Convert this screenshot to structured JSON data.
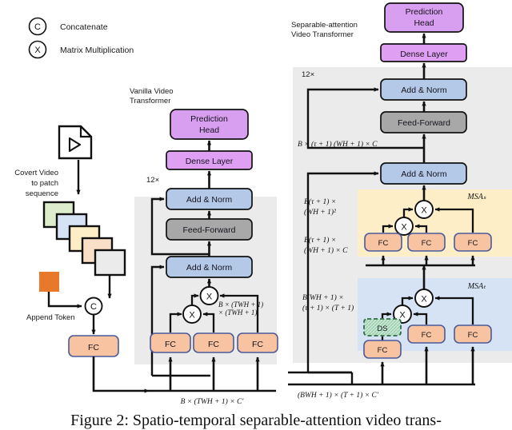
{
  "figure": {
    "caption": "Figure 2:  Spatio-temporal separable-attention video trans-"
  },
  "legend": {
    "items": [
      {
        "symbol": "C",
        "label": "Concatenate"
      },
      {
        "symbol": "X",
        "label": "Matrix Multiplication"
      }
    ]
  },
  "input_pipeline": {
    "video_icon_name": "video-file-icon",
    "convert_label_line1": "Covert Video",
    "convert_label_line2": "to patch",
    "convert_label_line3": "sequence",
    "append_token_label": "Append Token",
    "concat_symbol": "C",
    "fc_label": "FC",
    "patch_colors": [
      "#dceccd",
      "#d6e3f5",
      "#fdeec8",
      "#fadfc8",
      "#ebebeb"
    ],
    "append_token_color": "#e8782a"
  },
  "vanilla": {
    "title_line1": "Vanilla Video",
    "title_line2": "Transformer",
    "repeat_label": "12×",
    "prediction_head": "Prediction Head",
    "prediction_head_line1": "Prediction",
    "prediction_head_line2": "Head",
    "dense_layer": "Dense Layer",
    "add_norm_top": "Add & Norm",
    "feed_forward": "Feed-Forward",
    "add_norm_bottom": "Add & Norm",
    "fc_labels": [
      "FC",
      "FC",
      "FC"
    ],
    "matmul_symbol": "X",
    "attn_shape_line1": "B × (TWH + 1)",
    "attn_shape_line2": "× (TWH + 1)",
    "input_shape": "B × (TWH + 1)  × C′"
  },
  "separable": {
    "title_line1": "Separable-attention",
    "title_line2": "Video Transformer",
    "repeat_label": "12×",
    "prediction_head_line1": "Prediction",
    "prediction_head_line2": "Head",
    "dense_layer": "Dense Layer",
    "add_norm_top": "Add & Norm",
    "feed_forward": "Feed-Forward",
    "add_norm_mid": "Add & Norm",
    "ff_shape": "B × (τ + 1) (WH + 1) × C",
    "msa_s": {
      "name": "MSAₛ",
      "attn_shape_line1": "B(τ + 1) ×",
      "attn_shape_line2": "(WH + 1)²",
      "input_shape_line1": "B(τ + 1) ×",
      "input_shape_line2": "(WH + 1) × C",
      "fc_labels": [
        "FC",
        "FC",
        "FC"
      ],
      "matmul_symbol": "X",
      "bg_color": "#fdeec8"
    },
    "msa_t": {
      "name": "MSAₜ",
      "attn_shape_line1": "B(WH + 1) ×",
      "attn_shape_line2": "(τ + 1) × (T + 1)",
      "ds_label": "DS",
      "fc_labels": [
        "FC",
        "FC",
        "FC"
      ],
      "matmul_symbol": "X",
      "bg_color": "#d6e3f5"
    },
    "input_shape": "(BWH + 1) × (T + 1) × C′"
  },
  "colors": {
    "prediction_head": "#d89ef0",
    "dense_layer": "#df9ff2",
    "add_norm": "#b4c8e8",
    "feed_forward": "#a8a8a8",
    "fc": "#f7c3a0",
    "fc_border": "#4a5a9a",
    "panel_bg": "#ebebeb",
    "ds_fill": "#bfe3cc",
    "ds_border": "#2e6b44",
    "stroke": "#111111"
  }
}
